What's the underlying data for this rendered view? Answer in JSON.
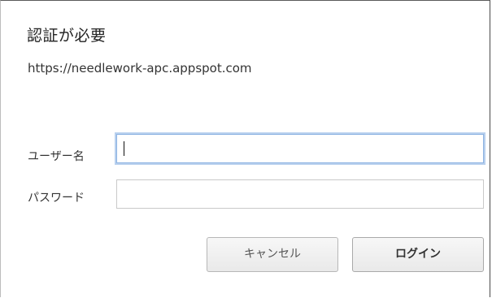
{
  "dialog": {
    "title": "認証が必要",
    "origin": "https://needlework-apc.appspot.com"
  },
  "form": {
    "username_label": "ユーザー名",
    "username_value": "",
    "password_label": "パスワード",
    "password_value": ""
  },
  "buttons": {
    "cancel_label": "キャンセル",
    "login_label": "ログイン"
  },
  "colors": {
    "focus_ring": "#8db3e2",
    "button_bg": "#efefef"
  }
}
